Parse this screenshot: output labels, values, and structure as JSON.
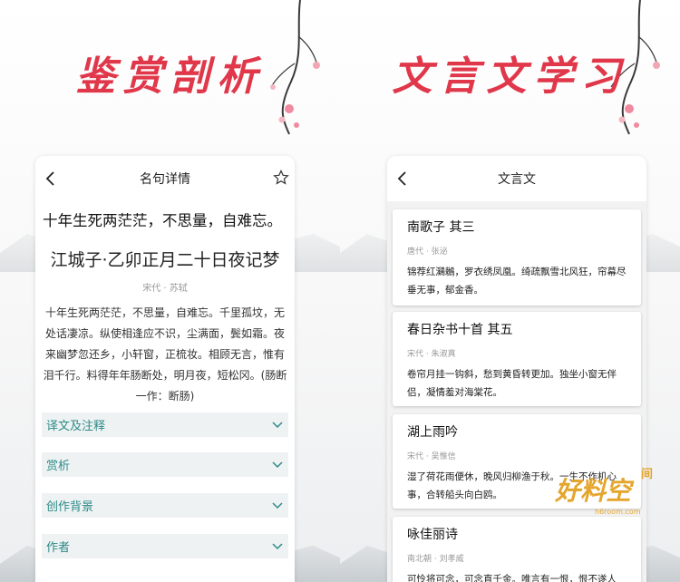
{
  "left": {
    "hero_title": "鉴赏剖析",
    "phone": {
      "nav_title": "名句详情",
      "quote": "十年生死两茫茫，不思量，自难忘。",
      "poem_title": "江城子·乙卯正月二十日夜记梦",
      "meta": "宋代 · 苏轼",
      "body": "十年生死两茫茫，不思量，自难忘。千里孤坟，无处话凄凉。纵使相逢应不识，尘满面，鬓如霜。夜来幽梦忽还乡，小轩窗，正梳妆。相顾无言，惟有泪千行。料得年年肠断处，明月夜，短松冈。(肠断 一作：断肠)",
      "sections": [
        "译文及注释",
        "赏析",
        "创作背景",
        "作者"
      ]
    }
  },
  "right": {
    "hero_title": "文言文学习",
    "phone": {
      "nav_title": "文言文",
      "cards": [
        {
          "title": "南歌子 其三",
          "author": "唐代 · 张泌",
          "excerpt": "锦荐红鸂鶒，罗衣绣凤凰。绮疏飘雪北风狂，帘幕尽垂无事，郁金香。"
        },
        {
          "title": "春日杂书十首 其五",
          "author": "宋代 · 朱淑真",
          "excerpt": "卷帘月挂一钩斜，愁到黄昏转更加。独坐小窗无伴侣，凝情羞对海棠花。"
        },
        {
          "title": "湖上雨吟",
          "author": "宋代 · 吴惟信",
          "excerpt": "湿了荷花雨便休，晚风归柳渔于秋。一生不作机心事，合转船头向白鸥。"
        },
        {
          "title": "咏佳丽诗",
          "author": "南北朝 · 刘孝威",
          "excerpt": "可怜将可念，可念直千金。唯言有一恨，恨不遂人"
        }
      ]
    }
  },
  "watermark": {
    "main": "好料空",
    "small": "间",
    "url": "h6room.com"
  },
  "colors": {
    "hero_red": "#e0384a",
    "section_teal": "#2d8a88",
    "watermark_gold": "#e4a52c"
  }
}
